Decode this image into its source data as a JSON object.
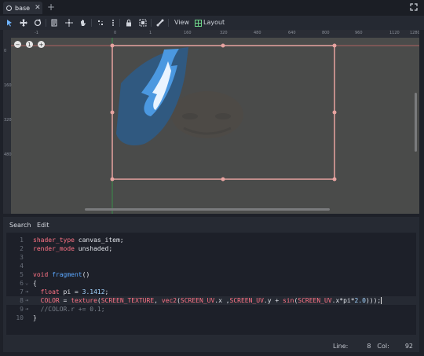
{
  "tabbar": {
    "tab_label": "base",
    "add_tab": "+"
  },
  "toolbar": {
    "view_label": "View",
    "layout_label": "Layout"
  },
  "ruler": {
    "top_ticks": [
      "-1",
      "0",
      "1",
      "160",
      "320",
      "480",
      "640",
      "800",
      "960",
      "1120",
      "1280"
    ],
    "left_ticks": [
      "0",
      "160",
      "320",
      "480"
    ]
  },
  "editor": {
    "menu": {
      "search_label": "Search",
      "edit_label": "Edit"
    },
    "lines": [
      {
        "n": "1",
        "parts": [
          [
            "kw",
            "shader_type"
          ],
          [
            "plain",
            " canvas_item;"
          ]
        ]
      },
      {
        "n": "2",
        "parts": [
          [
            "kw",
            "render_mode"
          ],
          [
            "plain",
            " unshaded;"
          ]
        ]
      },
      {
        "n": "3",
        "parts": []
      },
      {
        "n": "4",
        "parts": []
      },
      {
        "n": "5",
        "parts": [
          [
            "kw",
            "void"
          ],
          [
            "plain",
            " "
          ],
          [
            "fn",
            "fragment"
          ],
          [
            "plain",
            "()"
          ]
        ]
      },
      {
        "n": "6",
        "parts": [
          [
            "plain",
            "{"
          ]
        ]
      },
      {
        "n": "7",
        "parts": [
          [
            "plain",
            "  "
          ],
          [
            "kw",
            "float"
          ],
          [
            "plain",
            " pi = "
          ],
          [
            "num",
            "3.1412"
          ],
          [
            "plain",
            ";"
          ]
        ]
      },
      {
        "n": "8",
        "parts": [
          [
            "plain",
            "  "
          ],
          [
            "kw",
            "COLOR"
          ],
          [
            "plain",
            " = "
          ],
          [
            "kw",
            "texture"
          ],
          [
            "plain",
            "("
          ],
          [
            "kw",
            "SCREEN_TEXTURE"
          ],
          [
            "plain",
            ", "
          ],
          [
            "kw",
            "vec2"
          ],
          [
            "plain",
            "("
          ],
          [
            "kw",
            "SCREEN_UV"
          ],
          [
            "plain",
            ".x ,"
          ],
          [
            "kw",
            "SCREEN_UV"
          ],
          [
            "plain",
            ".y + "
          ],
          [
            "kw",
            "sin"
          ],
          [
            "plain",
            "("
          ],
          [
            "kw",
            "SCREEN_UV"
          ],
          [
            "plain",
            ".x*pi*"
          ],
          [
            "num",
            "2.0"
          ],
          [
            "plain",
            ")));"
          ]
        ]
      },
      {
        "n": "9",
        "parts": [
          [
            "plain",
            "  "
          ],
          [
            "cm",
            "//COLOR.r += 0.1;"
          ]
        ]
      },
      {
        "n": "10",
        "parts": [
          [
            "plain",
            "}"
          ]
        ]
      }
    ],
    "current_line": "8",
    "status": {
      "line_label": "Line:",
      "line_value": "8",
      "col_label": "Col:",
      "col_value": "92"
    }
  },
  "colors": {
    "accent": "#ff7385",
    "function": "#5ca8ff",
    "number": "#a3d4ff",
    "selection_rect": "#e7a3a0",
    "viewport_bg": "#4a4b4a"
  }
}
